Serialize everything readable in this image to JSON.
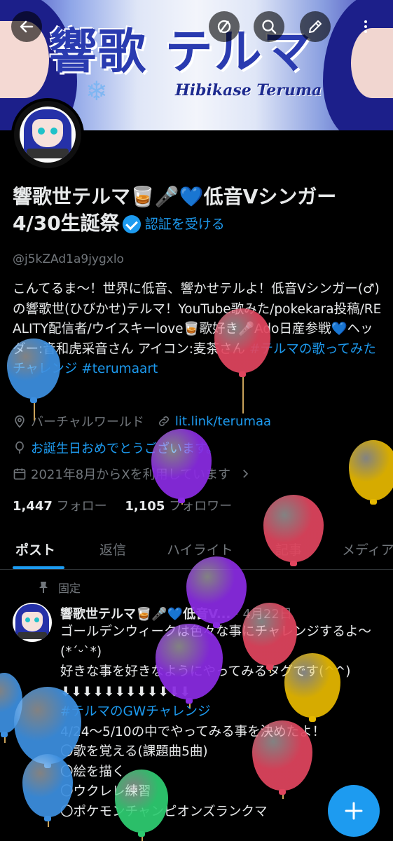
{
  "banner": {
    "title": "響歌 テルマ",
    "subtitle": "Hibikase Teruma"
  },
  "topbar": {
    "back_icon": "arrow-left-icon",
    "icons": [
      "hide-icon",
      "search-icon",
      "edit-icon",
      "more-vertical-icon"
    ]
  },
  "profile": {
    "name": "響歌世テルマ🥃🎤💙低音Vシンガー4/30生誕祭",
    "verify_link": "認証を受ける",
    "handle": "@j5kZAd1a9jygxlo",
    "bio_text": "こんてるま～！世界に低音、響かせテルよ！低音Vシンガー(♂)の響歌世(ひびかせ)テルマ！YouTube歌みた/pokekara投稿/REALITY配信者/ウイスキーlove🥃歌好き🎤Ado日産参戦💙ヘッダー:音和虎采音さん アイコン:麦茶さん ",
    "bio_tag1": "#テルマの歌ってみたチャレンジ",
    "bio_tag2": "#terumaart",
    "location": "バーチャルワールド",
    "link": "lit.link/terumaa",
    "birthday": "お誕生日おめでとうございます。",
    "joined": "2021年8月からXを利用しています",
    "following_count": "1,447",
    "following_label": "フォロー",
    "followers_count": "1,105",
    "followers_label": "フォロワー"
  },
  "tabs": [
    "ポスト",
    "返信",
    "ハイライト",
    "記事",
    "メディア"
  ],
  "pinned_post": {
    "pinned_label": "固定",
    "author": "響歌世テルマ🥃🎤💙低音V...",
    "date": "· 4月22日",
    "line1": "ゴールデンウィークは色々な事にチャレンジするよ～(*ˊᵕˋ*)",
    "line2": "好きな事を好きなようにやってみるタグです(^^)",
    "line3": "⬇⬇⬇⬇⬇⬇⬇⬇⬇⬇⬇⬇",
    "tag": "#テルマのGWチャレンジ",
    "line4": "4/24～5/10の中でやってみる事を決めたよ！",
    "items": [
      "〇歌を覚える(課題曲5曲)",
      "〇絵を描く",
      "〇ウクレレ練習",
      "〇ポケモンチャンピオンズランクマ"
    ]
  },
  "fab": {
    "icon": "plus-icon"
  },
  "colors": {
    "accent": "#1d9bf0",
    "background": "#000000",
    "text": "#e7e9ea",
    "muted": "#71767b"
  }
}
